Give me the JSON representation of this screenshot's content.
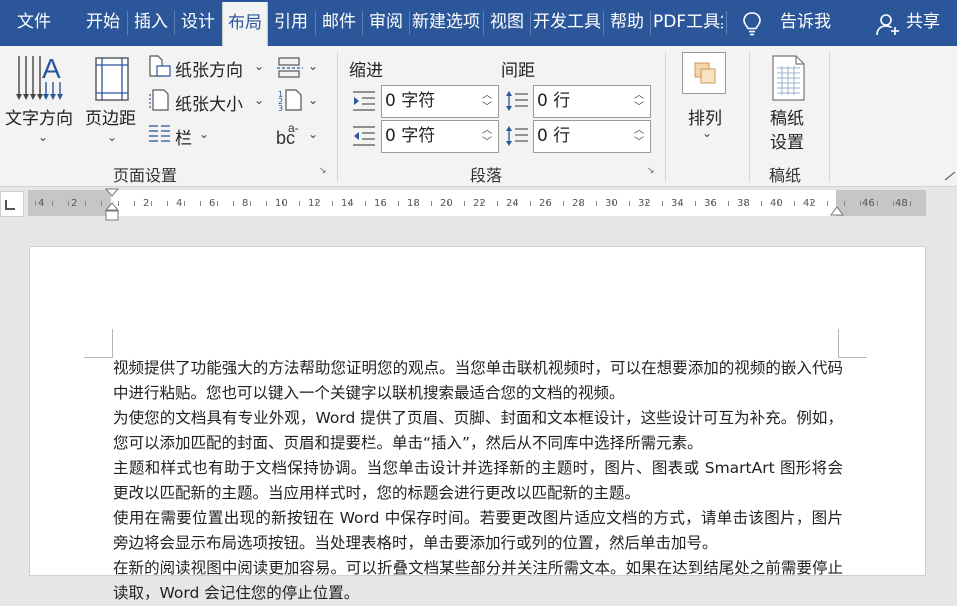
{
  "tabs": [
    {
      "label": "文件"
    },
    {
      "label": "开始"
    },
    {
      "label": "插入"
    },
    {
      "label": "设计"
    },
    {
      "label": "布局"
    },
    {
      "label": "引用"
    },
    {
      "label": "邮件"
    },
    {
      "label": "审阅"
    },
    {
      "label": "新建选项卡"
    },
    {
      "label": "视图"
    },
    {
      "label": "开发工具"
    },
    {
      "label": "帮助"
    },
    {
      "label": "PDF工具集"
    }
  ],
  "tell_me": "告诉我",
  "share": "共享",
  "ribbon": {
    "page_setup": {
      "text_direction": "文字方向",
      "margins": "页边距",
      "orientation": "纸张方向",
      "size": "纸张大小",
      "columns": "栏",
      "group_label": "页面设置"
    },
    "paragraph": {
      "indent_label": "缩进",
      "spacing_label": "间距",
      "indent_left": "0 字符",
      "indent_right": "0 字符",
      "spacing_before": "0 行",
      "spacing_after": "0 行",
      "group_label": "段落"
    },
    "arrange": {
      "label": "排列"
    },
    "manuscript": {
      "button_line1": "稿纸",
      "button_line2": "设置",
      "group_label": "稿纸"
    }
  },
  "ruler": {
    "labels": [
      "4",
      "2",
      "2",
      "4",
      "6",
      "8",
      "10",
      "12",
      "14",
      "16",
      "18",
      "20",
      "22",
      "24",
      "26",
      "28",
      "30",
      "32",
      "34",
      "36",
      "38",
      "40",
      "42",
      "46",
      "48"
    ]
  },
  "document": {
    "paragraphs": [
      "视频提供了功能强大的方法帮助您证明您的观点。当您单击联机视频时，可以在想要添加的视频的嵌入代码中进行粘贴。您也可以键入一个关键字以联机搜索最适合您的文档的视频。",
      "为使您的文档具有专业外观，Word 提供了页眉、页脚、封面和文本框设计，这些设计可互为补充。例如，您可以添加匹配的封面、页眉和提要栏。单击“插入”，然后从不同库中选择所需元素。",
      "主题和样式也有助于文档保持协调。当您单击设计并选择新的主题时，图片、图表或 SmartArt 图形将会更改以匹配新的主题。当应用样式时，您的标题会进行更改以匹配新的主题。",
      "使用在需要位置出现的新按钮在 Word 中保存时间。若要更改图片适应文档的方式，请单击该图片，图片旁边将会显示布局选项按钮。当处理表格时，单击要添加行或列的位置，然后单击加号。",
      "在新的阅读视图中阅读更加容易。可以折叠文档某些部分并关注所需文本。如果在达到结尾处之前需要停止读取，Word 会记住您的停止位置。"
    ]
  },
  "colors": {
    "accent": "#2b579a",
    "ribbon_bg": "#f3f3f3",
    "canvas_bg": "#e6e6e6"
  }
}
